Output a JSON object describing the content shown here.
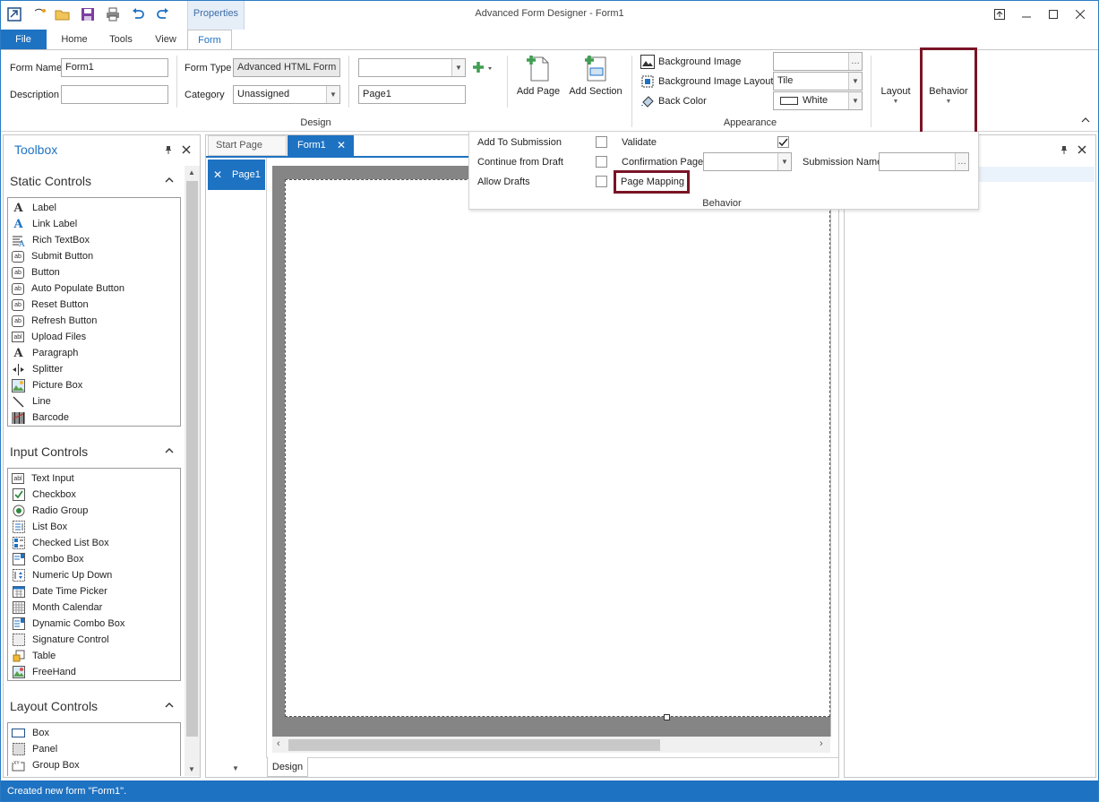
{
  "window": {
    "title": "Advanced Form Designer - Form1",
    "context_tab": "Properties"
  },
  "ribbon_tabs": {
    "file": "File",
    "home": "Home",
    "tools": "Tools",
    "view": "View",
    "form": "Form"
  },
  "design_group": {
    "label": "Design",
    "form_name_label": "Form Name",
    "form_name_value": "Form1",
    "description_label": "Description",
    "description_value": "",
    "form_type_label": "Form Type",
    "form_type_value": "Advanced HTML Form",
    "category_label": "Category",
    "category_value": "Unassigned",
    "page_select_value": "",
    "page_name_value": "Page1",
    "add_page": "Add Page",
    "add_section": "Add Section"
  },
  "appearance_group": {
    "label": "Appearance",
    "background_image": "Background Image",
    "background_image_value": "",
    "background_image_layout": "Background Image Layout",
    "background_image_layout_value": "Tile",
    "back_color": "Back Color",
    "back_color_value": "White"
  },
  "layout_button": "Layout",
  "behavior_button": "Behavior",
  "behavior_panel": {
    "label": "Behavior",
    "add_to_submission": "Add To Submission",
    "continue_from_draft": "Continue from Draft",
    "allow_drafts": "Allow Drafts",
    "validate": "Validate",
    "validate_checked": true,
    "confirmation_page": "Confirmation Page",
    "confirmation_page_value": "",
    "page_mapping": "Page Mapping",
    "submission_name": "Submission Name",
    "submission_name_value": ""
  },
  "toolbox": {
    "title": "Toolbox",
    "static_header": "Static Controls",
    "static_items": [
      "Label",
      "Link Label",
      "Rich TextBox",
      "Submit Button",
      "Button",
      "Auto Populate Button",
      "Reset Button",
      "Refresh Button",
      "Upload Files",
      "Paragraph",
      "Splitter",
      "Picture Box",
      "Line",
      "Barcode"
    ],
    "input_header": "Input Controls",
    "input_items": [
      "Text Input",
      "Checkbox",
      "Radio Group",
      "List Box",
      "Checked List Box",
      "Combo Box",
      "Numeric Up Down",
      "Date Time Picker",
      "Month Calendar",
      "Dynamic Combo Box",
      "Signature Control",
      "Table",
      "FreeHand"
    ],
    "layout_header": "Layout Controls",
    "layout_items": [
      "Box",
      "Panel",
      "Group Box"
    ]
  },
  "document": {
    "tab_start": "Start Page",
    "tab_form": "Form1",
    "page_tab": "Page1",
    "bottom_tab": "Design"
  },
  "status": "Created new form \"Form1\".",
  "colors": {
    "accent": "#1e72c2",
    "highlight": "#7a1426"
  }
}
